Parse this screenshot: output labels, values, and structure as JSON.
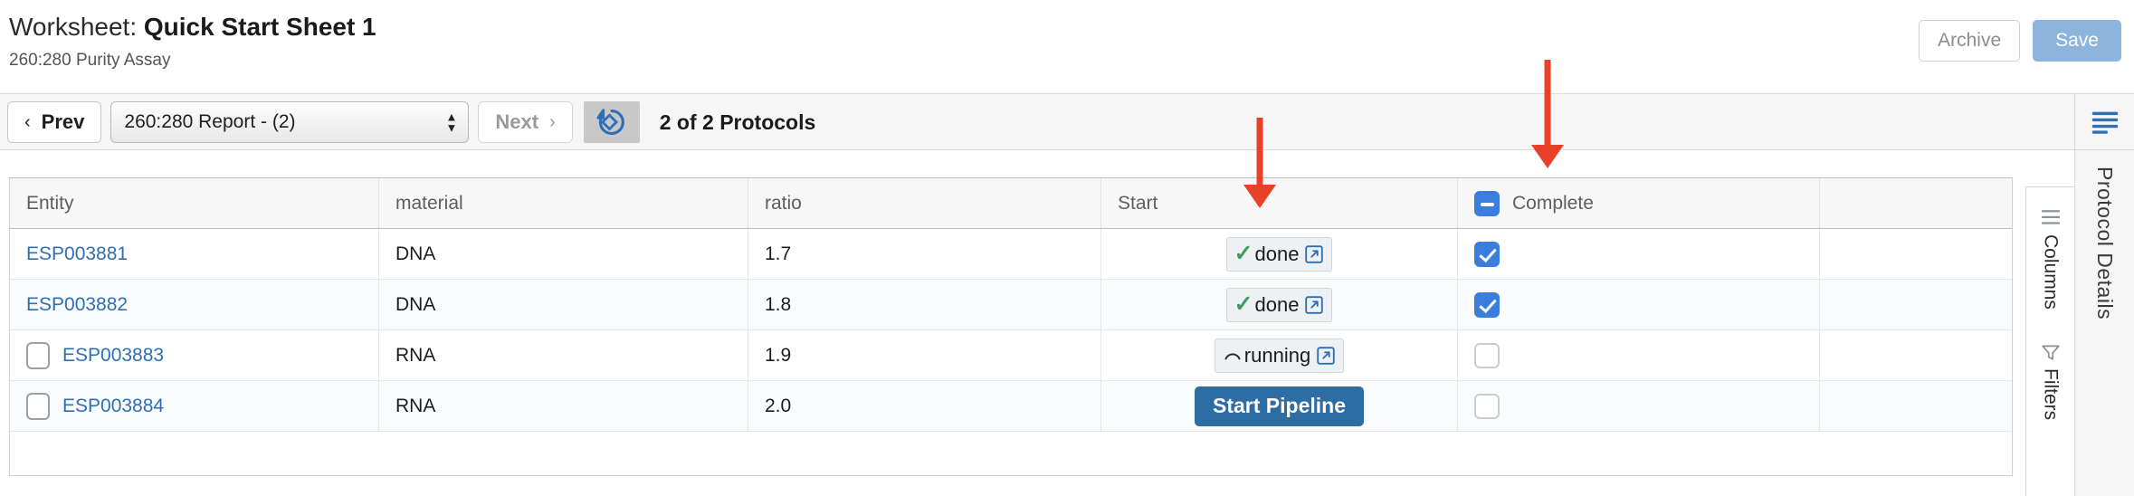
{
  "header": {
    "title_prefix": "Worksheet:",
    "title_name": "Quick Start Sheet 1",
    "subtitle": "260:280 Purity Assay",
    "archive_label": "Archive",
    "save_label": "Save"
  },
  "toolbar": {
    "prev_label": "Prev",
    "prev_chevron": "‹",
    "next_label": "Next",
    "next_chevron": "›",
    "protocol_select_value": "260:280 Report - (2)",
    "spin_up": "▲",
    "spin_down": "▼",
    "refresh_icon": "reset-diamond-icon",
    "protocol_count": "2 of 2 Protocols"
  },
  "right_rail": {
    "menu_icon": "hamburger-menu-icon",
    "panel_label": "Protocol Details",
    "columns_label": "Columns",
    "filters_label": "Filters",
    "columns_icon": "columns-icon",
    "filters_icon": "funnel-icon"
  },
  "table": {
    "columns": [
      {
        "key": "entity",
        "label": "Entity"
      },
      {
        "key": "material",
        "label": "material"
      },
      {
        "key": "ratio",
        "label": "ratio"
      },
      {
        "key": "start",
        "label": "Start"
      },
      {
        "key": "complete",
        "label": "Complete"
      }
    ],
    "header_complete_checkbox_state": "indeterminate",
    "rows": [
      {
        "select_checkbox": false,
        "show_select_checkbox": false,
        "entity": "ESP003881",
        "material": "DNA",
        "ratio": "1.7",
        "start_type": "status",
        "start_label": "done",
        "start_icon": "check-icon",
        "complete_state": "checked"
      },
      {
        "select_checkbox": false,
        "show_select_checkbox": false,
        "entity": "ESP003882",
        "material": "DNA",
        "ratio": "1.8",
        "start_type": "status",
        "start_label": "done",
        "start_icon": "check-icon",
        "complete_state": "checked"
      },
      {
        "select_checkbox": false,
        "show_select_checkbox": true,
        "entity": "ESP003883",
        "material": "RNA",
        "ratio": "1.9",
        "start_type": "status",
        "start_label": "running",
        "start_icon": "spinner-icon",
        "complete_state": "empty"
      },
      {
        "select_checkbox": false,
        "show_select_checkbox": true,
        "entity": "ESP003884",
        "material": "RNA",
        "ratio": "2.0",
        "start_type": "button",
        "start_label": "Start Pipeline",
        "start_icon": "",
        "complete_state": "empty"
      }
    ]
  },
  "annotations": {
    "arrow_color": "#e8412a",
    "arrows": [
      {
        "name": "arrow-pointing-to-start-column"
      },
      {
        "name": "arrow-pointing-to-complete-column"
      }
    ]
  },
  "colors": {
    "accent_blue": "#2f6fb5",
    "checkbox_blue": "#3b7ddd",
    "pipeline_button": "#2e6da4",
    "save_button": "#8cb4dd",
    "done_green": "#3f9b63",
    "annotation_red": "#e8412a"
  }
}
